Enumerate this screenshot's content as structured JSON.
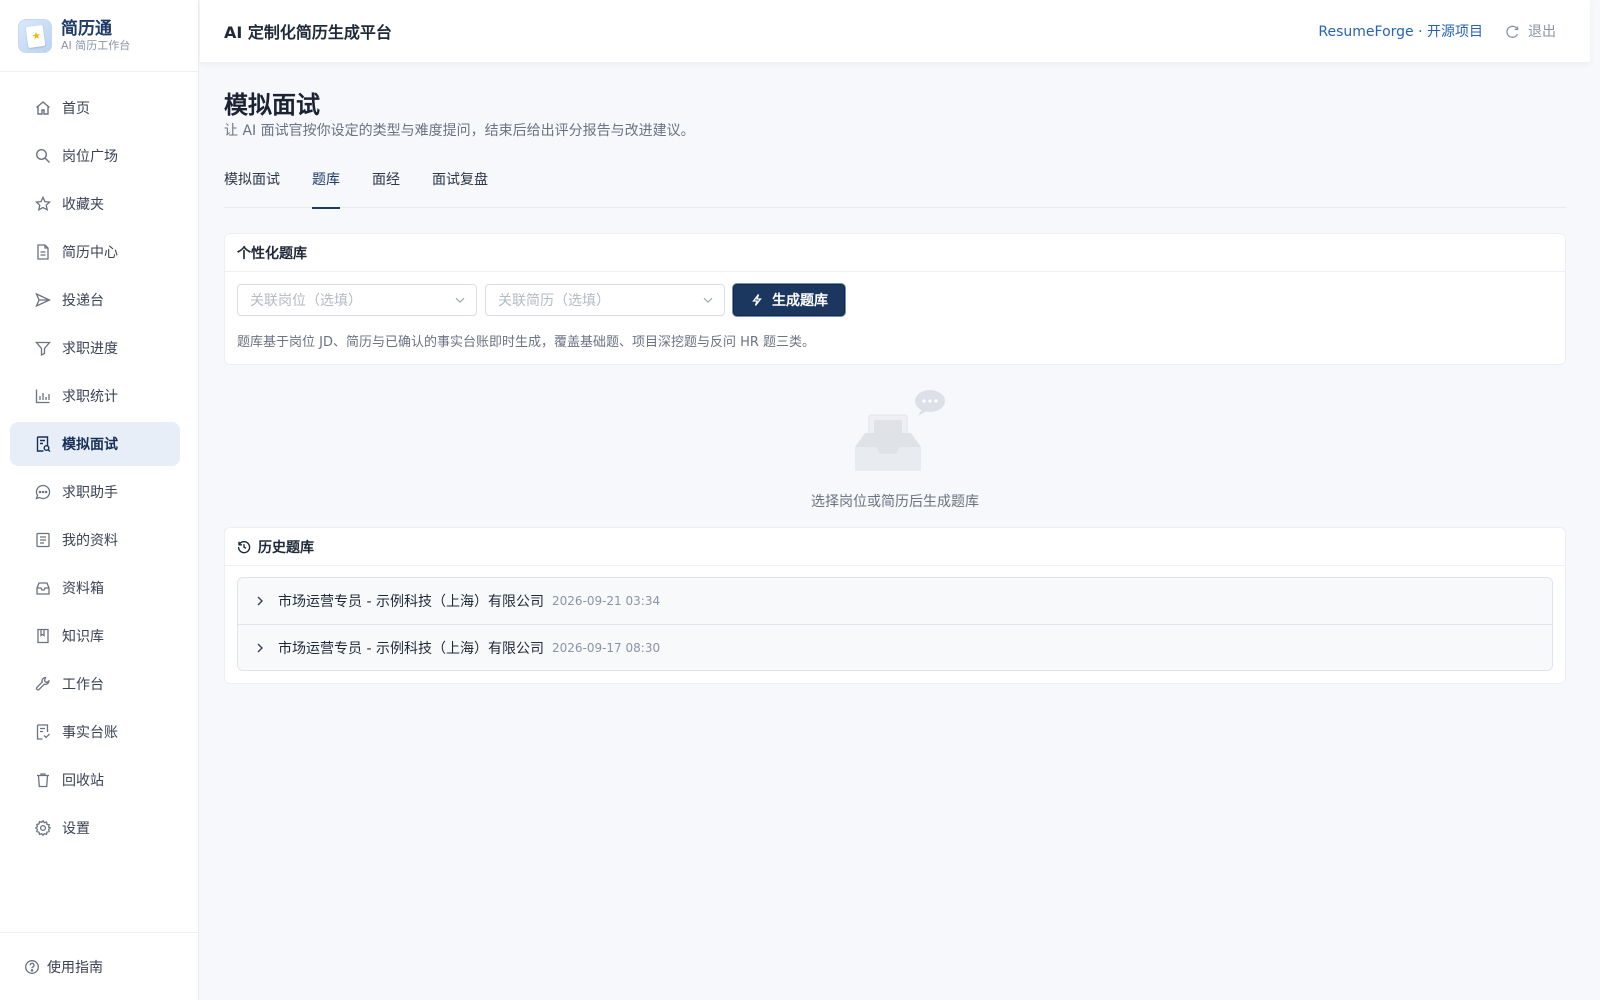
{
  "brand": {
    "name": "简历通",
    "subtitle": "AI 简历工作台"
  },
  "sidebar": {
    "items": [
      {
        "label": "首页",
        "icon": "home-icon"
      },
      {
        "label": "岗位广场",
        "icon": "search-icon"
      },
      {
        "label": "收藏夹",
        "icon": "star-icon"
      },
      {
        "label": "简历中心",
        "icon": "document-icon"
      },
      {
        "label": "投递台",
        "icon": "send-icon"
      },
      {
        "label": "求职进度",
        "icon": "funnel-icon"
      },
      {
        "label": "求职统计",
        "icon": "bar-chart-icon"
      },
      {
        "label": "模拟面试",
        "icon": "interview-icon",
        "active": true
      },
      {
        "label": "求职助手",
        "icon": "chat-icon"
      },
      {
        "label": "我的资料",
        "icon": "list-icon"
      },
      {
        "label": "资料箱",
        "icon": "inbox-icon"
      },
      {
        "label": "知识库",
        "icon": "book-icon"
      },
      {
        "label": "工作台",
        "icon": "wrench-icon"
      },
      {
        "label": "事实台账",
        "icon": "ledger-icon"
      },
      {
        "label": "回收站",
        "icon": "trash-icon"
      },
      {
        "label": "设置",
        "icon": "gear-icon"
      }
    ],
    "footer_label": "使用指南"
  },
  "header": {
    "title": "AI 定制化简历生成平台",
    "link_label": "ResumeForge · 开源项目",
    "logout_label": "退出"
  },
  "page": {
    "title": "模拟面试",
    "description": "让 AI 面试官按你设定的类型与难度提问，结束后给出评分报告与改进建议。"
  },
  "tabs": [
    {
      "label": "模拟面试"
    },
    {
      "label": "题库",
      "active": true
    },
    {
      "label": "面经"
    },
    {
      "label": "面试复盘"
    }
  ],
  "question_bank": {
    "title": "个性化题库",
    "job_placeholder": "关联岗位（选填）",
    "resume_placeholder": "关联简历（选填）",
    "generate_label": "生成题库",
    "hint": "题库基于岗位 JD、简历与已确认的事实台账即时生成，覆盖基础题、项目深挖题与反问 HR 题三类。"
  },
  "empty_state": {
    "text": "选择岗位或简历后生成题库"
  },
  "history": {
    "title": "历史题库",
    "items": [
      {
        "title": "市场运营专员 - 示例科技（上海）有限公司",
        "date": "2026-09-21 03:34"
      },
      {
        "title": "市场运营专员 - 示例科技（上海）有限公司",
        "date": "2026-09-17 08:30"
      }
    ]
  },
  "colors": {
    "primary": "#1b365f",
    "active_nav_bg": "#e8eef8",
    "link": "#2563b8",
    "background": "#f6f8fb"
  }
}
